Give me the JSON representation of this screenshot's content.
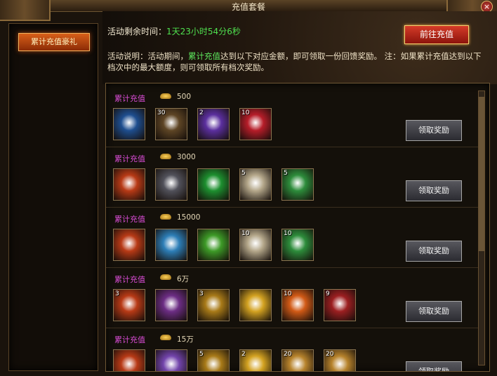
{
  "window": {
    "title": "充值套餐"
  },
  "left_menu": {
    "active_label": "累计充值豪礼"
  },
  "event": {
    "time_label": "活动剩余时间：",
    "time_value": "1天23小时54分6秒",
    "recharge_button": "前往充值"
  },
  "description": {
    "part1": "活动说明：活动期间，",
    "highlight": "累计充值",
    "part2": "达到以下对应金额，即可领取一份回馈奖励。 注：如果累计充值达到以下档次中的最大额度，则可领取所有档次奖励。"
  },
  "tiers": [
    {
      "label": "累计充值",
      "amount": "500",
      "claim": "领取奖励",
      "items": [
        {
          "icon": "blue-book-icon",
          "qty": "",
          "color": "#1e4e8f"
        },
        {
          "icon": "brown-rod-icon",
          "qty": "30",
          "color": "#5e4525"
        },
        {
          "icon": "blue-orb-icon",
          "qty": "2",
          "color": "#5b2f9e"
        },
        {
          "icon": "red-gem-chest-icon",
          "qty": "10",
          "color": "#b61d29"
        }
      ]
    },
    {
      "label": "累计充值",
      "amount": "3000",
      "claim": "领取奖励",
      "items": [
        {
          "icon": "red-book-icon",
          "qty": "",
          "color": "#b83a16"
        },
        {
          "icon": "gray-stone-icon",
          "qty": "",
          "color": "#51515a"
        },
        {
          "icon": "green-crystal-icon",
          "qty": "",
          "color": "#1d8f2f"
        },
        {
          "icon": "white-bottle-icon",
          "qty": "5",
          "color": "#b4a78a"
        },
        {
          "icon": "green-bottle-icon",
          "qty": "5",
          "color": "#2d8c3b"
        }
      ]
    },
    {
      "label": "累计充值",
      "amount": "15000",
      "claim": "领取奖励",
      "items": [
        {
          "icon": "red-book-icon",
          "qty": "",
          "color": "#b83a16"
        },
        {
          "icon": "blue-gem-icon",
          "qty": "",
          "color": "#2d7eb7"
        },
        {
          "icon": "green-gem-icon",
          "qty": "",
          "color": "#3d9a27"
        },
        {
          "icon": "white-bottle-icon",
          "qty": "10",
          "color": "#b4a78a"
        },
        {
          "icon": "green-bottle-icon",
          "qty": "10",
          "color": "#2d8c3b"
        }
      ]
    },
    {
      "label": "累计充值",
      "amount": "6万",
      "claim": "领取奖励",
      "items": [
        {
          "icon": "red-book-icon",
          "qty": "3",
          "color": "#b83a16"
        },
        {
          "icon": "purple-rune-icon",
          "qty": "",
          "color": "#6c2d84"
        },
        {
          "icon": "gold-beetle-icon",
          "qty": "3",
          "color": "#a87a18"
        },
        {
          "icon": "gold-coin-icon",
          "qty": "",
          "color": "#d3a221"
        },
        {
          "icon": "fire-scroll-icon",
          "qty": "10",
          "color": "#d15a16"
        },
        {
          "icon": "red-rose-icon",
          "qty": "9",
          "color": "#9c1f21"
        }
      ]
    },
    {
      "label": "累计充值",
      "amount": "15万",
      "claim": "领取奖励",
      "items": [
        {
          "icon": "red-book-icon",
          "qty": "",
          "color": "#b83a16"
        },
        {
          "icon": "purple-crystal-icon",
          "qty": "",
          "color": "#7244ab"
        },
        {
          "icon": "gold-beetle-icon",
          "qty": "5",
          "color": "#a87a18"
        },
        {
          "icon": "gold-coin-icon",
          "qty": "2",
          "color": "#d3a221"
        },
        {
          "icon": "gold-ornament-icon",
          "qty": "20",
          "color": "#b7832c"
        },
        {
          "icon": "gold-ornament-icon",
          "qty": "20",
          "color": "#b7832c"
        }
      ]
    }
  ]
}
